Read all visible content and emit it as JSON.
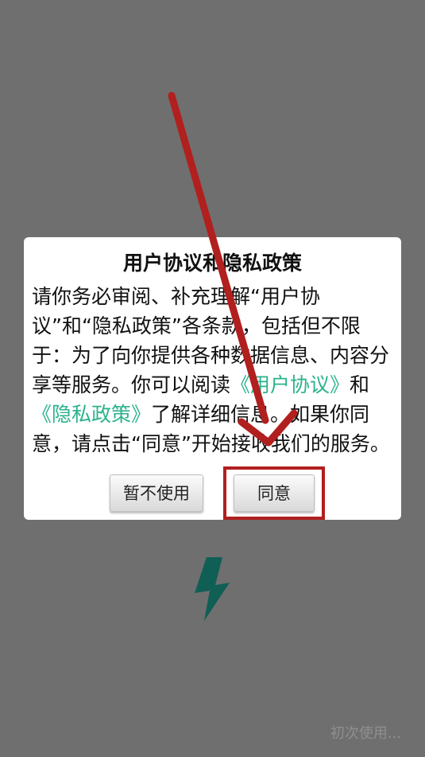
{
  "dialog": {
    "title": "用户协议和隐私政策",
    "body_part1": "请你务必审阅、补充理解“用户协议”和“隐私政策”各条款，包括但不限于：为了向你提供各种数据信息、内容分享等服务。你可以阅读",
    "user_agreement_link": "《用户协议》",
    "body_part2": "和",
    "privacy_policy_link": "《隐私政策》",
    "body_part3": "了解详细信息。如果你同意，请点击“同意”开始接收我们的服务。",
    "decline_button": "暂不使用",
    "agree_button": "同意"
  },
  "status": {
    "loading_text": "初次使用..."
  },
  "colors": {
    "backdrop": "#6f6f6f",
    "link": "#2bb38d",
    "annotation": "#b11f1f",
    "logo": "#0f5f55"
  },
  "icons": {
    "app_logo": "lightning-bolt-icon",
    "annotation_arrow": "red-arrow-icon"
  }
}
